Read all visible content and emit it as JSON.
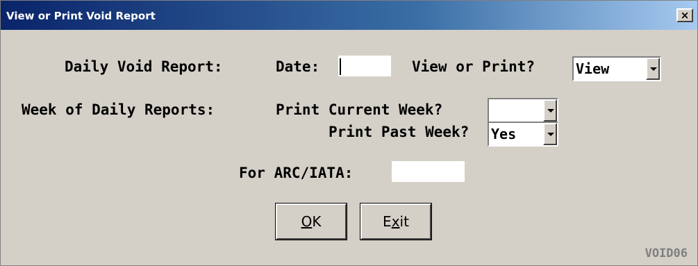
{
  "window": {
    "title": "View or Print Void Report",
    "close_glyph": "×",
    "form_code": "VOID06"
  },
  "daily": {
    "label": "Daily Void Report:",
    "date_label": "Date:",
    "date_value": "",
    "view_print_label": "View or Print?",
    "view_print_value": "View"
  },
  "weekly": {
    "label": "Week of Daily Reports:",
    "current_label": "Print Current Week?",
    "current_value": "",
    "past_label": "Print Past Week?",
    "past_value": "Yes"
  },
  "arc": {
    "label": "For ARC/IATA:",
    "value": ""
  },
  "buttons": {
    "ok_mnemonic": "O",
    "ok_rest": "K",
    "exit_pre": "E",
    "exit_mnemonic": "x",
    "exit_rest": "it"
  },
  "icons": {
    "close": "close-icon",
    "dropdown": "chevron-down-icon"
  }
}
